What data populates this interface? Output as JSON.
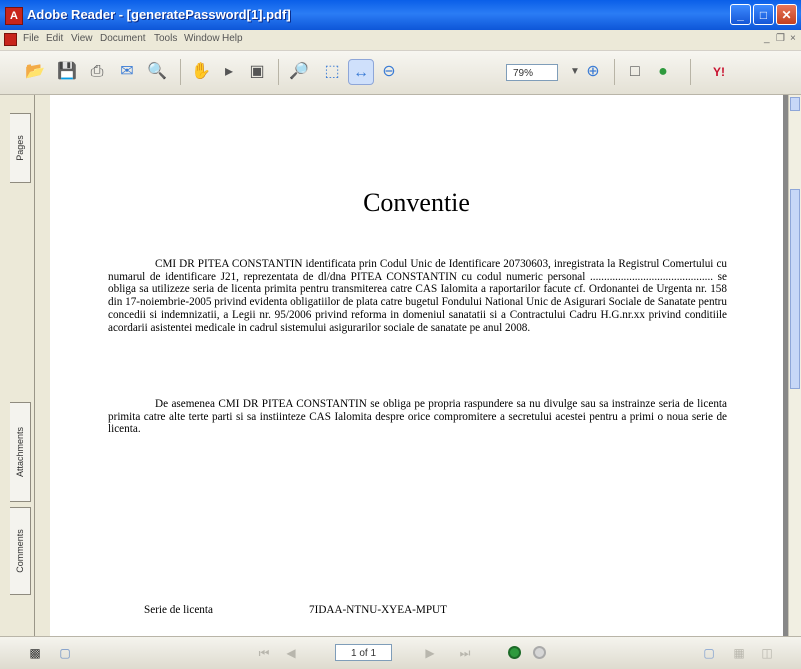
{
  "window": {
    "title": "Adobe Reader - [generatePassword[1].pdf]",
    "app_icon": "adobe-reader-icon",
    "controls": {
      "minimize": "_",
      "maximize": "□",
      "close": "✕"
    }
  },
  "menu": {
    "items": [
      "File",
      "Edit",
      "View",
      "Document",
      "Tools",
      "Window",
      "Help"
    ],
    "mdi": {
      "minimize": "_",
      "restore": "❐",
      "close": "×"
    }
  },
  "toolbar": {
    "zoom_value": "79%",
    "icons": [
      "open-icon",
      "save-icon",
      "print-icon",
      "email-icon",
      "search-icon",
      "hand-tool-icon",
      "select-tool-icon",
      "snapshot-icon",
      "zoom-in-icon",
      "fit-page-icon",
      "fit-width-icon",
      "zoom-out-icon",
      "zoom-in-plus-icon",
      "page-layout-icon",
      "help-icon",
      "yahoo-icon"
    ],
    "yahoo_label": "Y!"
  },
  "left_panel": {
    "tabs": [
      "Pages",
      "Attachments",
      "Comments"
    ]
  },
  "document": {
    "title": "Conventie",
    "paragraph_1": "CMI DR PITEA CONSTANTIN identificata prin Codul Unic de Identificare 20730603, inregistrata la Registrul Comertului cu numarul de identificare J21, reprezentata de dl/dna  PITEA CONSTANTIN  cu codul numeric personal ............................................ se obliga sa utilizeze seria de licenta primita pentru transmiterea catre CAS Ialomita a raportarilor facute cf. Ordonantei de Urgenta nr. 158 din 17-noiembrie-2005 privind evidenta obligatiilor de plata catre bugetul Fondului National Unic de Asigurari Sociale de Sanatate pentru concedii si indemnizatii, a Legii nr. 95/2006 privind reforma in domeniul sanatatii si a Contractului Cadru H.G.nr.xx privind conditiile acordarii asistentei medicale in cadrul sistemului asigurarilor sociale de sanatate pe anul 2008.",
    "paragraph_2": "De asemenea CMI DR PITEA CONSTANTIN se obliga pe propria raspundere sa nu divulge sau sa instrainze seria de licenta primita catre alte terte parti si sa instiinteze CAS Ialomita despre orice compromitere a secretului acestei pentru a primi o noua serie de licenta.",
    "license_label": "Serie de licenta",
    "license_value": "7IDAA-NTNU-XYEA-MPUT"
  },
  "statusbar": {
    "page_indicator": "1 of 1",
    "icons": [
      "save-copy-icon",
      "properties-icon",
      "first-page-icon",
      "previous-page-icon",
      "next-page-icon",
      "last-page-icon",
      "go-back-icon",
      "go-forward-icon",
      "single-page-icon",
      "continuous-icon",
      "facing-icon"
    ]
  }
}
